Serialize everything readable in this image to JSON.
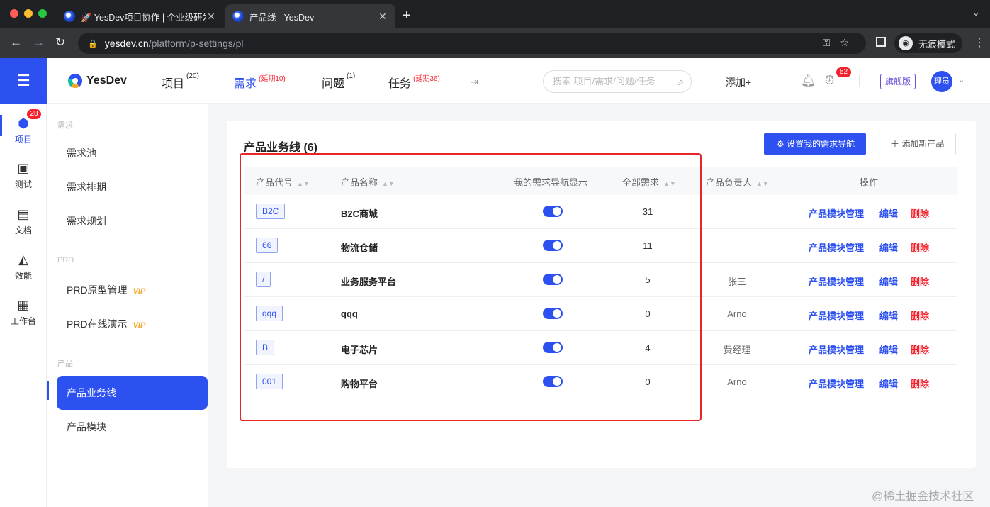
{
  "browser": {
    "tabs": [
      {
        "title": "🚀 YesDev项目协作 | 企业级研发"
      },
      {
        "title": "产品线 - YesDev"
      }
    ],
    "url_host": "yesdev.cn",
    "url_path": "/platform/p-settings/pl",
    "incognito_label": "无痕模式"
  },
  "rail": {
    "items": [
      {
        "label": "项目",
        "icon": "cube-icon",
        "badge": "28"
      },
      {
        "label": "测试",
        "icon": "test-icon"
      },
      {
        "label": "文档",
        "icon": "document-icon"
      },
      {
        "label": "效能",
        "icon": "chart-icon"
      },
      {
        "label": "工作台",
        "icon": "grid-icon"
      }
    ]
  },
  "topbar": {
    "logo": "YesDev",
    "nav": [
      {
        "label": "项目",
        "badge": "(20)"
      },
      {
        "label": "需求",
        "badge": "(延期10)"
      },
      {
        "label": "问题",
        "badge": "(1)"
      },
      {
        "label": "任务",
        "badge": "(延期36)"
      }
    ],
    "search_placeholder": "搜索 项目/需求/问题/任务",
    "add_label": "添加+",
    "clock_badge": "52",
    "edition": "旗舰版",
    "avatar": "理员"
  },
  "sidebar": {
    "group_demand": "需求",
    "group_prd": "PRD",
    "group_product": "产品",
    "items": [
      {
        "label": "需求池"
      },
      {
        "label": "需求排期"
      },
      {
        "label": "需求规划"
      },
      {
        "label": "PRD原型管理",
        "vip": "VIP"
      },
      {
        "label": "PRD在线演示",
        "vip": "VIP"
      },
      {
        "label": "产品业务线"
      },
      {
        "label": "产品模块"
      }
    ]
  },
  "main": {
    "title": "产品业务线 (6)",
    "primary_button": "设置我的需求导航",
    "add_button": "添加新产品",
    "columns": [
      "产品代号",
      "产品名称",
      "我的需求导航显示",
      "全部需求",
      "产品负责人",
      "操作"
    ],
    "rows": [
      {
        "code": "B2C",
        "name": "B2C商城",
        "nav_shown": true,
        "count": "31",
        "owner": ""
      },
      {
        "code": "66",
        "name": "物流仓储",
        "nav_shown": true,
        "count": "11",
        "owner": ""
      },
      {
        "code": "/",
        "name": "业务服务平台",
        "nav_shown": true,
        "count": "5",
        "owner": "张三"
      },
      {
        "code": "qqq",
        "name": "qqq",
        "nav_shown": true,
        "count": "0",
        "owner": "Arno"
      },
      {
        "code": "B",
        "name": "电子芯片",
        "nav_shown": true,
        "count": "4",
        "owner": "费经理"
      },
      {
        "code": "001",
        "name": "购物平台",
        "nav_shown": true,
        "count": "0",
        "owner": "Arno"
      }
    ],
    "actions": {
      "module": "产品模块管理",
      "edit": "编辑",
      "delete": "删除"
    }
  },
  "watermark": "@稀土掘金技术社区",
  "colors": {
    "accent": "#2d50f0",
    "danger": "#f5222d",
    "vip": "#f6a623"
  }
}
